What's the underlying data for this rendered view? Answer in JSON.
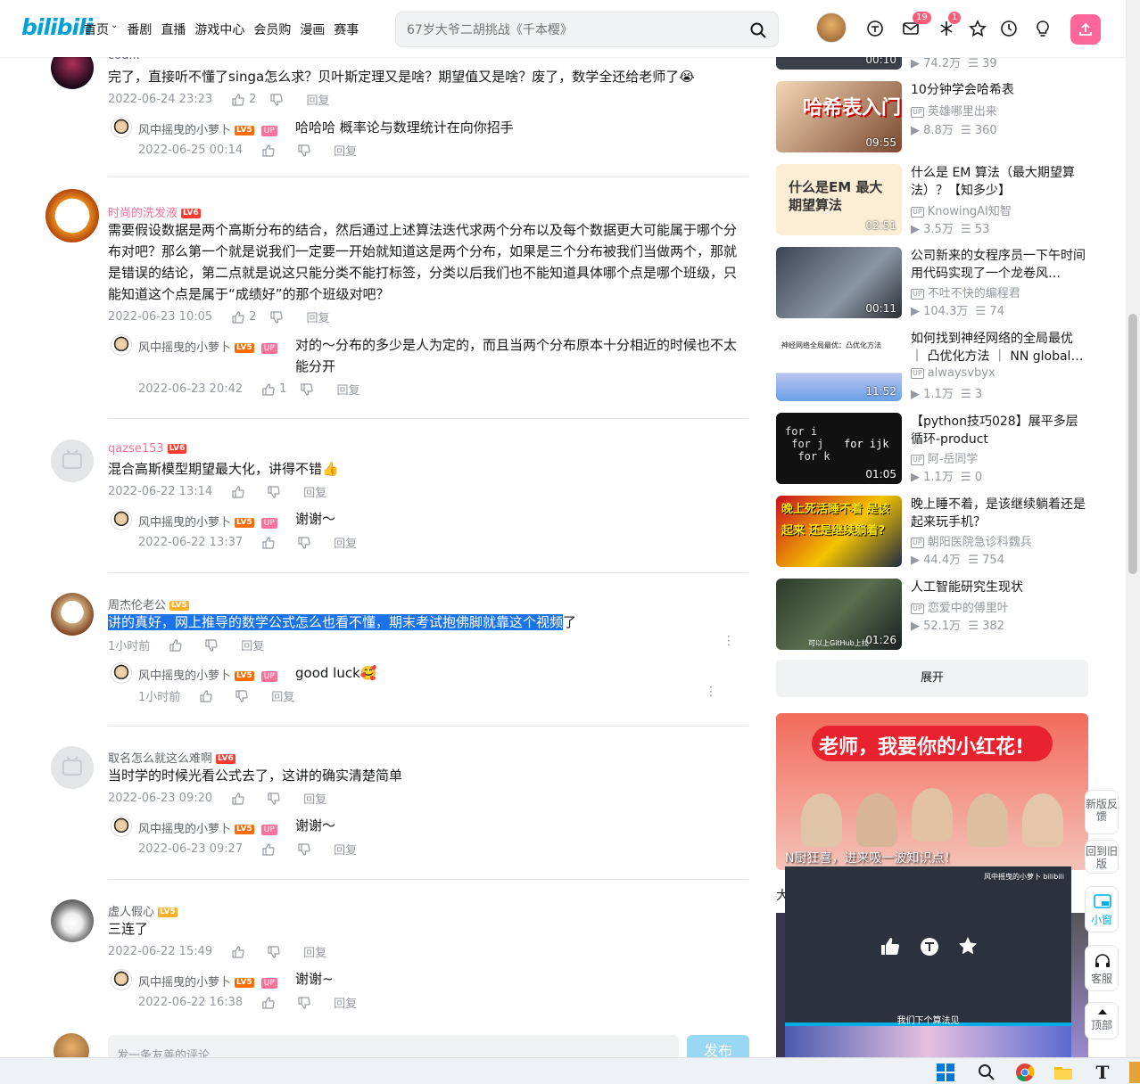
{
  "header": {
    "logo": "bilibili",
    "nav": [
      "首页",
      "番剧",
      "直播",
      "游戏中心",
      "会员购",
      "漫画",
      "赛事"
    ],
    "search_placeholder": "67岁大爷二胡挑战《千本樱》",
    "badges": {
      "messages": "19",
      "dynamics": "1"
    }
  },
  "comments": [
    {
      "user": "cod...",
      "text": "完了，直接听不懂了singa怎么求？贝叶斯定理又是啥？期望值又是啥？废了，数学全还给老师了😭",
      "time": "2022-06-24 23:23",
      "likes": "2",
      "reply_label": "回复",
      "replies": [
        {
          "user": "风中摇曳的小萝卜",
          "text": "哈哈哈 概率论与数理统计在向你招手",
          "time": "2022-06-25 00:14",
          "reply_label": "回复"
        }
      ]
    },
    {
      "user": "时尚的洗发液",
      "text": "需要假设数据是两个高斯分布的结合，然后通过上述算法迭代求两个分布以及每个数据更大可能属于哪个分布对吧？那么第一个就是说我们一定要一开始就知道这是两个分布，如果是三个分布被我们当做两个，那就是错误的结论，第二点就是说这只能分类不能打标签，分类以后我们也不能知道具体哪个点是哪个班级，只能知道这个点是属于“成绩好”的那个班级对吧？",
      "time": "2022-06-23 10:05",
      "likes": "2",
      "reply_label": "回复",
      "replies": [
        {
          "user": "风中摇曳的小萝卜",
          "text": "对的～分布的多少是人为定的，而且当两个分布原本十分相近的时候也不太能分开",
          "time": "2022-06-23 20:42",
          "likes": "1",
          "reply_label": "回复"
        }
      ]
    },
    {
      "user": "qazse153",
      "text": "混合高斯模型期望最大化，讲得不错👍",
      "time": "2022-06-22 13:14",
      "reply_label": "回复",
      "replies": [
        {
          "user": "风中摇曳的小萝卜",
          "text": "谢谢～",
          "time": "2022-06-22 13:37",
          "reply_label": "回复"
        }
      ]
    },
    {
      "user": "周杰伦老公",
      "text_selected": "讲的真好，网上推导的数学公式怎么也看不懂，期末考试抱佛脚就靠这个视频",
      "text_rest": "了",
      "time": "1小时前",
      "reply_label": "回复",
      "replies": [
        {
          "user": "风中摇曳的小萝卜",
          "text": "good luck🥰",
          "time": "1小时前",
          "reply_label": "回复"
        }
      ]
    },
    {
      "user": "取名怎么就这么难啊",
      "text": "当时学的时候光看公式去了，这讲的确实清楚简单",
      "time": "2022-06-23 09:20",
      "reply_label": "回复",
      "replies": [
        {
          "user": "风中摇曳的小萝卜",
          "text": "谢谢～",
          "time": "2022-06-23 09:27",
          "reply_label": "回复"
        }
      ]
    },
    {
      "user": "虚人假心",
      "text": "三连了",
      "time": "2022-06-22 15:49",
      "reply_label": "回复",
      "replies": [
        {
          "user": "风中摇曳的小萝卜",
          "text": "谢谢~",
          "time": "2022-06-22 16:38",
          "reply_label": "回复"
        }
      ]
    }
  ],
  "composer": {
    "placeholder": "发一条友善的评论",
    "submit": "发布"
  },
  "related": [
    {
      "title": "",
      "up": "",
      "views": "74.2万",
      "danmaku": "39",
      "duration": "00:10"
    },
    {
      "title": "10分钟学会哈希表",
      "up": "英雄哪里出来",
      "views": "8.8万",
      "danmaku": "360",
      "duration": "09:55",
      "thumb_text": "哈希表入门"
    },
    {
      "title": "什么是 EM 算法（最大期望算法）？【知多少】",
      "up": "KnowingAI知智",
      "views": "3.5万",
      "danmaku": "53",
      "duration": "02:51",
      "thumb_text": "什么是EM 最大期望算法"
    },
    {
      "title": "公司新来的女程序员一下午时间用代码实现了一个龙卷风…",
      "up": "不吐不快的编程君",
      "views": "104.3万",
      "danmaku": "74",
      "duration": "00:11"
    },
    {
      "title": "如何找到神经网络的全局最优 ｜ 凸优化方法 ｜ NN global…",
      "up": "alwaysvbyx",
      "views": "1.1万",
      "danmaku": "3",
      "duration": "11:52",
      "thumb_text": "神经网络全局最优：凸优化方法"
    },
    {
      "title": "【python技巧028】展平多层循环-product",
      "up": "阿-岳同学",
      "views": "1.1万",
      "danmaku": "0",
      "duration": "01:05"
    },
    {
      "title": "晚上睡不着，是该继续躺着还是起来玩手机？",
      "up": "朝阳医院急诊科魏兵",
      "views": "44.4万",
      "danmaku": "754",
      "duration": "",
      "thumb_text": "晚上死活睡不着 是该起来 还是继续躺着?"
    },
    {
      "title": "人工智能研究生现状",
      "up": "恋爱中的傅里叶",
      "views": "52.1万",
      "danmaku": "382",
      "duration": "01:26",
      "thumb_text": "可以上GitHub上找"
    }
  ],
  "expand_label": "展开",
  "banner": {
    "headline": "老师，我要你的小红花!",
    "caption": "N厨狂喜，进来吸一波知识点！"
  },
  "mini_player": {
    "brand": "风中摇曳的小萝卜 bilibili",
    "subtitle": "我们下个算法见"
  },
  "side_buttons": [
    "新版反馈",
    "回到旧版",
    "小窗",
    "客服",
    "顶部"
  ],
  "colors": {
    "brand": "#00a1d6",
    "pink": "#fb7299",
    "selection": "#1a73e8"
  }
}
